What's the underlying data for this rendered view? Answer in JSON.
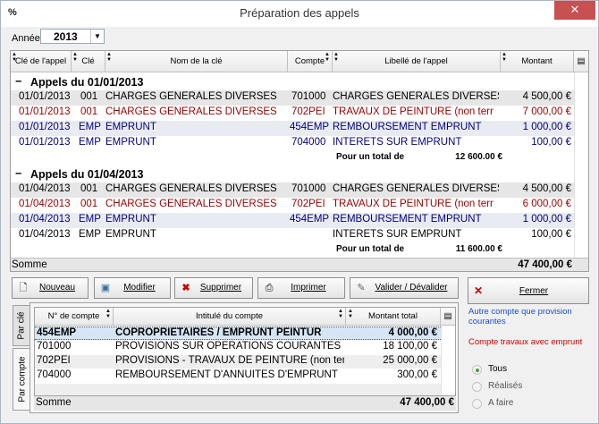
{
  "window": {
    "title": "Préparation des appels",
    "app_icon": "%",
    "close_glyph": "✕"
  },
  "year": {
    "label": "Année",
    "value": "2013"
  },
  "main_grid": {
    "columns": [
      "Clé de l'appel",
      "Clé",
      "Nom de la clé",
      "Compte",
      "Libellé de l'appel",
      "Montant"
    ],
    "groups": [
      {
        "title": "Appels du 01/01/2013",
        "rows": [
          {
            "date": "01/01/2013",
            "cle": "001",
            "nom": "CHARGES GENERALES DIVERSES",
            "compte": "701000",
            "libelle": "CHARGES GENERALES DIVERSES",
            "montant": "4 500,00 €",
            "style": "gray"
          },
          {
            "date": "01/01/2013",
            "cle": "001",
            "nom": "CHARGES GENERALES DIVERSES",
            "compte": "702PEI",
            "libelle": "TRAVAUX DE PEINTURE (non terr",
            "montant": "7 000,00 €",
            "style": "red"
          },
          {
            "date": "01/01/2013",
            "cle": "EMP",
            "nom": "EMPRUNT",
            "compte": "454EMP",
            "libelle": "REMBOURSEMENT EMPRUNT",
            "montant": "1 000,00 €",
            "style": "blue-bg"
          },
          {
            "date": "01/01/2013",
            "cle": "EMP",
            "nom": "EMPRUNT",
            "compte": "704000",
            "libelle": "INTERETS SUR EMPRUNT",
            "montant": "100,00 €",
            "style": "navy"
          }
        ],
        "total_label": "Pour un total de",
        "total": "12 600.00 €"
      },
      {
        "title": "Appels du 01/04/2013",
        "rows": [
          {
            "date": "01/04/2013",
            "cle": "001",
            "nom": "CHARGES GENERALES DIVERSES",
            "compte": "701000",
            "libelle": "CHARGES GENERALES DIVERSES",
            "montant": "4 500,00 €",
            "style": "gray"
          },
          {
            "date": "01/04/2013",
            "cle": "001",
            "nom": "CHARGES GENERALES DIVERSES",
            "compte": "702PEI",
            "libelle": "TRAVAUX DE PEINTURE (non terr",
            "montant": "6 000,00 €",
            "style": "red"
          },
          {
            "date": "01/04/2013",
            "cle": "EMP",
            "nom": "EMPRUNT",
            "compte": "454EMP",
            "libelle": "REMBOURSEMENT EMPRUNT",
            "montant": "1 000,00 €",
            "style": "blue-bg"
          },
          {
            "date": "01/04/2013",
            "cle": "EMP",
            "nom": "EMPRUNT",
            "compte": "",
            "libelle": "INTERETS SUR EMPRUNT",
            "montant": "100,00 €",
            "style": "plain"
          }
        ],
        "total_label": "Pour un total de",
        "total": "11 600.00 €"
      }
    ],
    "sum_label": "Somme",
    "sum_value": "47 400,00 €"
  },
  "toolbar": {
    "nouveau": "Nouveau",
    "modifier": "Modifier",
    "supprimer": "Supprimer",
    "imprimer": "Imprimer",
    "valider": "Valider / Dévalider",
    "fermer": "Fermer"
  },
  "tabs": {
    "par_cle": "Par clé",
    "par_compte": "Par compte"
  },
  "sub_grid": {
    "columns": [
      "N° de compte",
      "Intitulé du compte",
      "Montant total"
    ],
    "rows": [
      {
        "compte": "454EMP",
        "intitule": "COPROPRIETAIRES / EMPRUNT PEINTUR",
        "montant": "4 000,00 €",
        "style": "sel"
      },
      {
        "compte": "701000",
        "intitule": "PROVISIONS SUR OPERATIONS COURANTES",
        "montant": "18 100,00 €",
        "style": "plain"
      },
      {
        "compte": "702PEI",
        "intitule": "PROVISIONS - TRAVAUX DE PEINTURE (non ter",
        "montant": "25 000,00 €",
        "style": "alt"
      },
      {
        "compte": "704000",
        "intitule": "REMBOURSEMENT D'ANNUITES D'EMPRUNT",
        "montant": "300,00 €",
        "style": "plain"
      }
    ],
    "sum_label": "Somme",
    "sum_value": "47 400,00 €"
  },
  "legend": {
    "blue": "Autre compte que provision courantes",
    "red": "Compte travaux avec emprunt"
  },
  "filter": {
    "tous": "Tous",
    "realises": "Réalisés",
    "a_faire": "A faire",
    "selected": "tous"
  }
}
